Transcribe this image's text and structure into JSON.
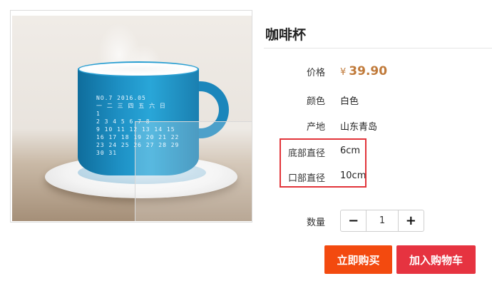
{
  "product": {
    "title": "咖啡杯",
    "price": {
      "label": "价格",
      "currency": "¥",
      "value": "39.90"
    },
    "specs": [
      {
        "label": "颜色",
        "value": "白色"
      },
      {
        "label": "产地",
        "value": "山东青岛"
      },
      {
        "label": "底部直径",
        "value": "6cm"
      },
      {
        "label": "口部直径",
        "value": "10cm"
      }
    ]
  },
  "quantity": {
    "label": "数量",
    "value": "1",
    "decrement": "−",
    "increment": "+"
  },
  "actions": {
    "buy_now": "立即购买",
    "add_to_cart": "加入购物车"
  },
  "image": {
    "calendar_lines": [
      "NO.7  2016.05",
      "一 二 三 四 五 六 日",
      "            1",
      "2 3 4 5 6 7 8",
      "9 10 11 12 13 14 15",
      "16 17 18 19 20 21 22",
      "23 24 25 26 27 28 29",
      "30 31"
    ]
  },
  "colors": {
    "price": "#c07a3a",
    "buy_now": "#f34a0f",
    "add_to_cart": "#e63340",
    "highlight": "#e2343a"
  }
}
